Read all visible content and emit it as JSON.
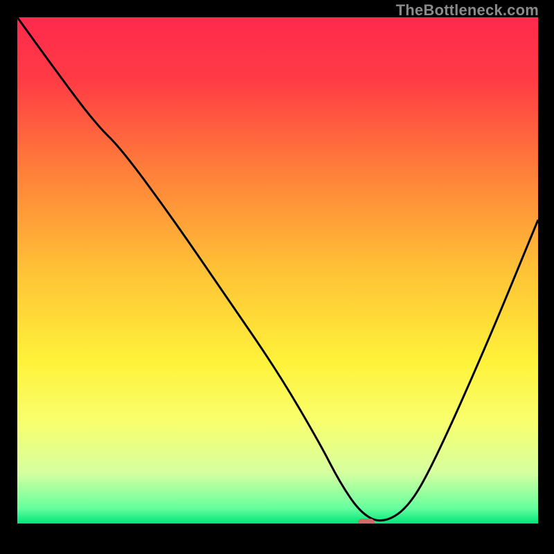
{
  "watermark": "TheBottleneck.com",
  "chart_data": {
    "type": "line",
    "title": "",
    "xlabel": "",
    "ylabel": "",
    "xlim": [
      0,
      100
    ],
    "ylim": [
      0,
      100
    ],
    "grid": false,
    "background_gradient": {
      "stops": [
        {
          "pct": 0,
          "color": "#ff2a4d"
        },
        {
          "pct": 12,
          "color": "#ff3a45"
        },
        {
          "pct": 30,
          "color": "#ff7e3a"
        },
        {
          "pct": 50,
          "color": "#ffc236"
        },
        {
          "pct": 68,
          "color": "#fff23a"
        },
        {
          "pct": 80,
          "color": "#f8ff6e"
        },
        {
          "pct": 90,
          "color": "#d6ffa0"
        },
        {
          "pct": 97,
          "color": "#66ff9e"
        },
        {
          "pct": 100,
          "color": "#00e47a"
        }
      ]
    },
    "series": [
      {
        "name": "bottleneck-curve",
        "color": "#000000",
        "x": [
          0,
          7,
          15,
          20,
          30,
          40,
          50,
          58,
          62,
          66,
          70,
          75,
          80,
          90,
          100
        ],
        "y": [
          100,
          90,
          79,
          74,
          60,
          45,
          30,
          16,
          8,
          2,
          0,
          3,
          12,
          35,
          60
        ]
      }
    ],
    "marker": {
      "name": "optimum-marker",
      "x": 67,
      "y": 0.2,
      "color": "#d46b6b",
      "width_pct": 3.2,
      "height_pct": 1.5
    }
  }
}
